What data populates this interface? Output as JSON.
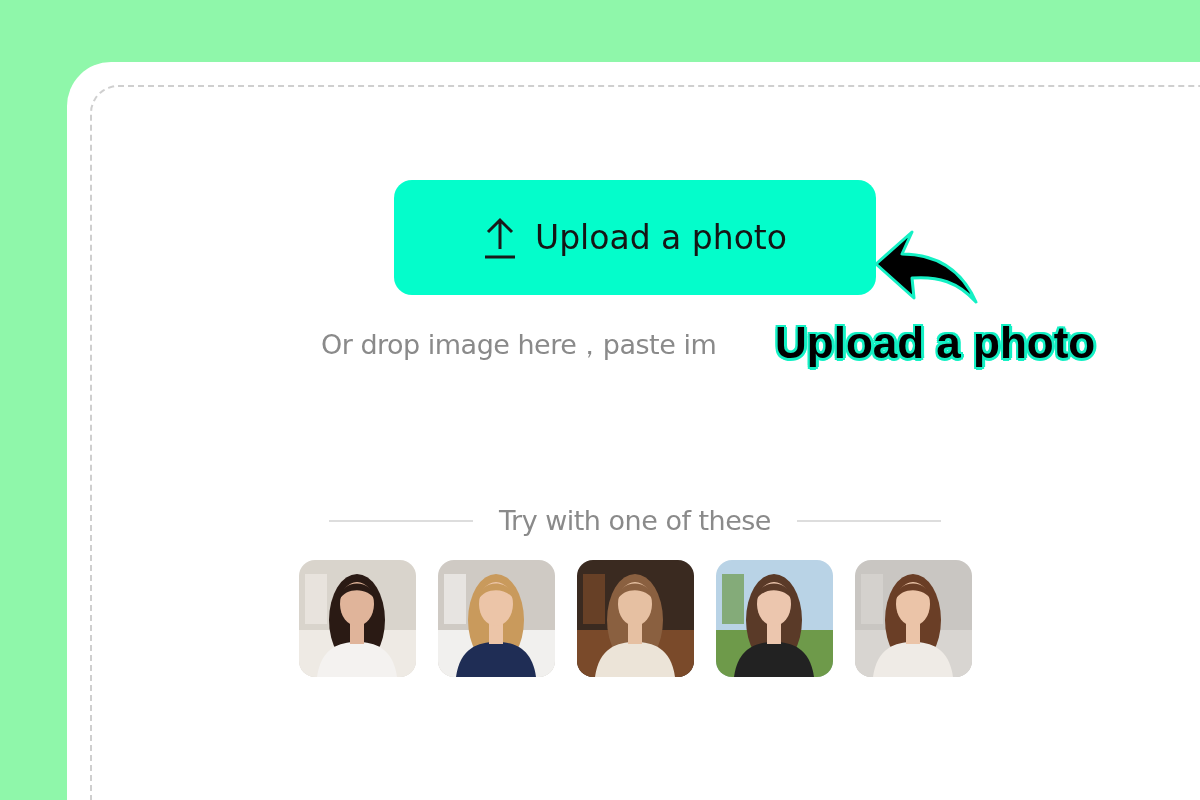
{
  "upload_button": {
    "label": "Upload a photo"
  },
  "drop_hint": "Or drop image here，paste im",
  "annotation": {
    "label": "Upload a photo"
  },
  "samples_heading": "Try with one of these"
}
